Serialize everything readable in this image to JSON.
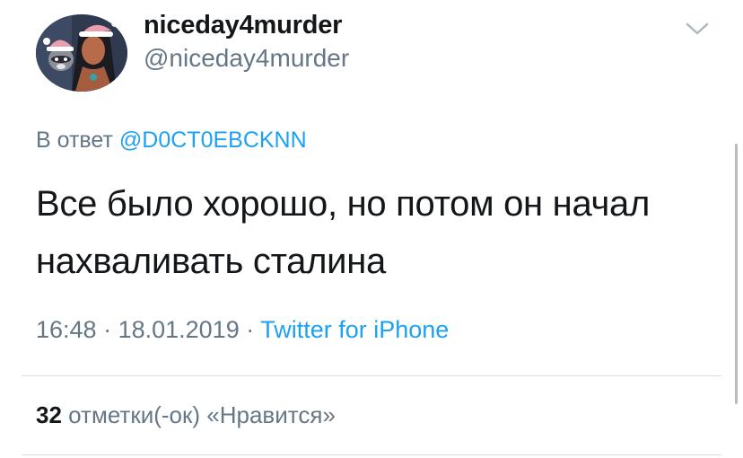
{
  "user": {
    "display_name": "niceday4murder",
    "handle": "@niceday4murder"
  },
  "icons": {
    "avatar": "profile-avatar-pocahontas-santa-hat",
    "chevron": "chevron-down-icon"
  },
  "reply": {
    "prefix": "В ответ ",
    "mention": "@D0CT0EBCKNN"
  },
  "tweet": {
    "text": "Все было хорошо, но потом он начал нахваливать сталина"
  },
  "meta": {
    "time": "16:48",
    "sep1": " · ",
    "date": "18.01.2019",
    "sep2": " · ",
    "source": "Twitter for iPhone"
  },
  "stats": {
    "likes_count": "32",
    "likes_label": " отметки(-ок) «Нравится»"
  },
  "colors": {
    "link": "#1da1f2",
    "secondary": "#657786",
    "text": "#14171a",
    "divider": "#d7dde2"
  }
}
